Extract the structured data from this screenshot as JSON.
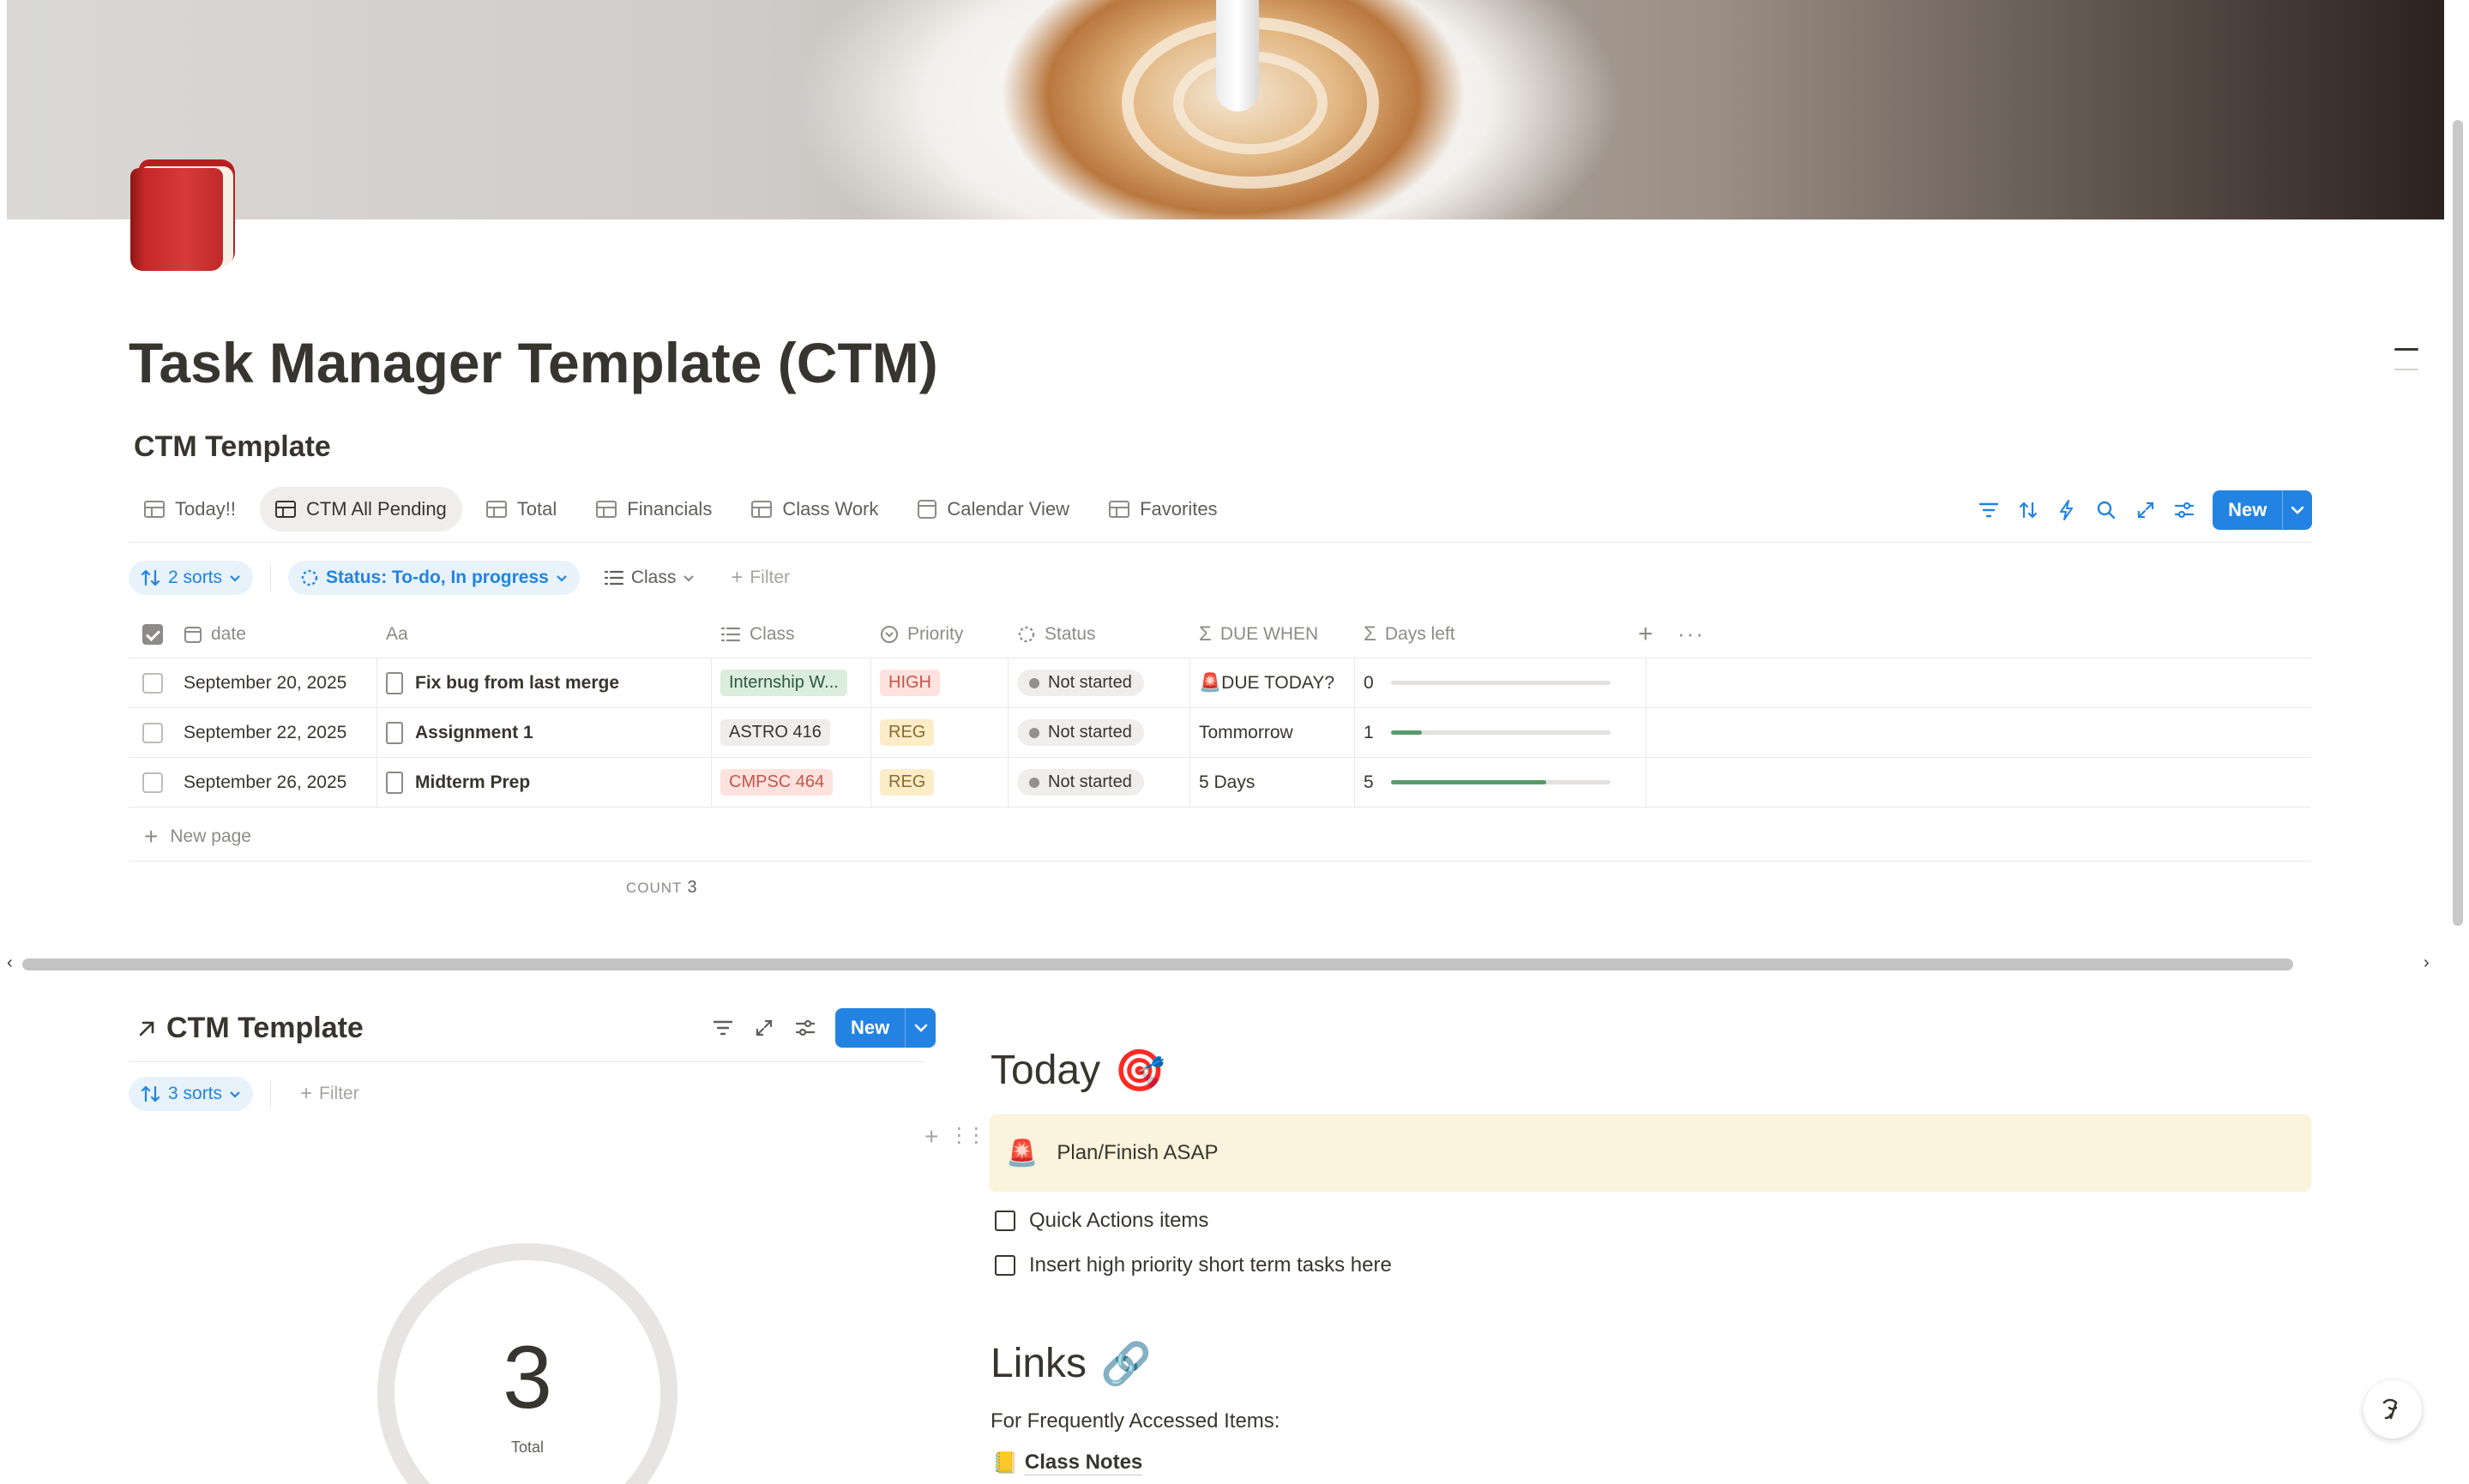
{
  "page": {
    "title": "Task Manager Template (CTM)"
  },
  "database": {
    "title": "CTM Template",
    "tabs": [
      {
        "label": "Today!!",
        "icon": "table-icon"
      },
      {
        "label": "CTM All Pending",
        "icon": "table-icon",
        "active": true
      },
      {
        "label": "Total",
        "icon": "table-icon"
      },
      {
        "label": "Financials",
        "icon": "table-icon"
      },
      {
        "label": "Class Work",
        "icon": "table-icon"
      },
      {
        "label": "Calendar View",
        "icon": "calendar-icon"
      },
      {
        "label": "Favorites",
        "icon": "table-icon"
      }
    ],
    "toolbar": {
      "new_label": "New",
      "icons": [
        "filter-icon",
        "sort-icon",
        "lightning-icon",
        "search-icon",
        "expand-icon",
        "settings-icon"
      ]
    },
    "filters": {
      "sorts": "2 sorts",
      "status": "Status: To-do, In progress",
      "class": "Class",
      "add_filter": "Filter"
    },
    "columns": {
      "date": "date",
      "title": "Aa",
      "class": "Class",
      "priority": "Priority",
      "status": "Status",
      "due_when": "DUE WHEN",
      "days_left": "Days left"
    },
    "rows": [
      {
        "date": "September 20, 2025",
        "title": "Fix bug from last merge",
        "class": "Internship W...",
        "priority": "HIGH",
        "status": "Not started",
        "due_when": "🚨DUE TODAY?",
        "days_left": "0",
        "progress": 0.0
      },
      {
        "date": "September 22, 2025",
        "title": "Assignment 1",
        "class": "ASTRO 416",
        "priority": "REG",
        "status": "Not started",
        "due_when": "Tommorrow",
        "days_left": "1",
        "progress": 0.14
      },
      {
        "date": "September 26, 2025",
        "title": "Midterm Prep",
        "class": "CMPSC 464",
        "priority": "REG",
        "status": "Not started",
        "due_when": "5 Days",
        "days_left": "5",
        "progress": 0.71
      }
    ],
    "new_page": "New page",
    "count_label": "COUNT",
    "count_value": "3"
  },
  "linked_db": {
    "title": "CTM Template",
    "new_label": "New",
    "sorts": "3 sorts",
    "add_filter": "Filter",
    "gauge_value": "3",
    "gauge_label": "Total"
  },
  "today": {
    "heading": "Today",
    "heading_emoji": "🎯",
    "callout_emoji": "🚨",
    "callout_text": "Plan/Finish ASAP",
    "todos": [
      "Quick Actions items",
      "Insert high priority short term tasks here"
    ]
  },
  "links": {
    "heading": "Links",
    "heading_emoji": "🔗",
    "intro": "For Frequently Accessed Items:",
    "items": [
      {
        "label": "Class Notes",
        "emoji": "📒"
      }
    ]
  },
  "colors": {
    "accent": "#2383e2",
    "tag_internship_bg": "#dbeddb",
    "tag_astro_bg": "#efeeec",
    "tag_cmpsc_bg": "#ffe2dd",
    "priority_high_bg": "#ffe2dd",
    "priority_reg_bg": "#fdecc8",
    "progress_fill": "#5a9a6a",
    "callout_bg": "#fbf3db"
  }
}
